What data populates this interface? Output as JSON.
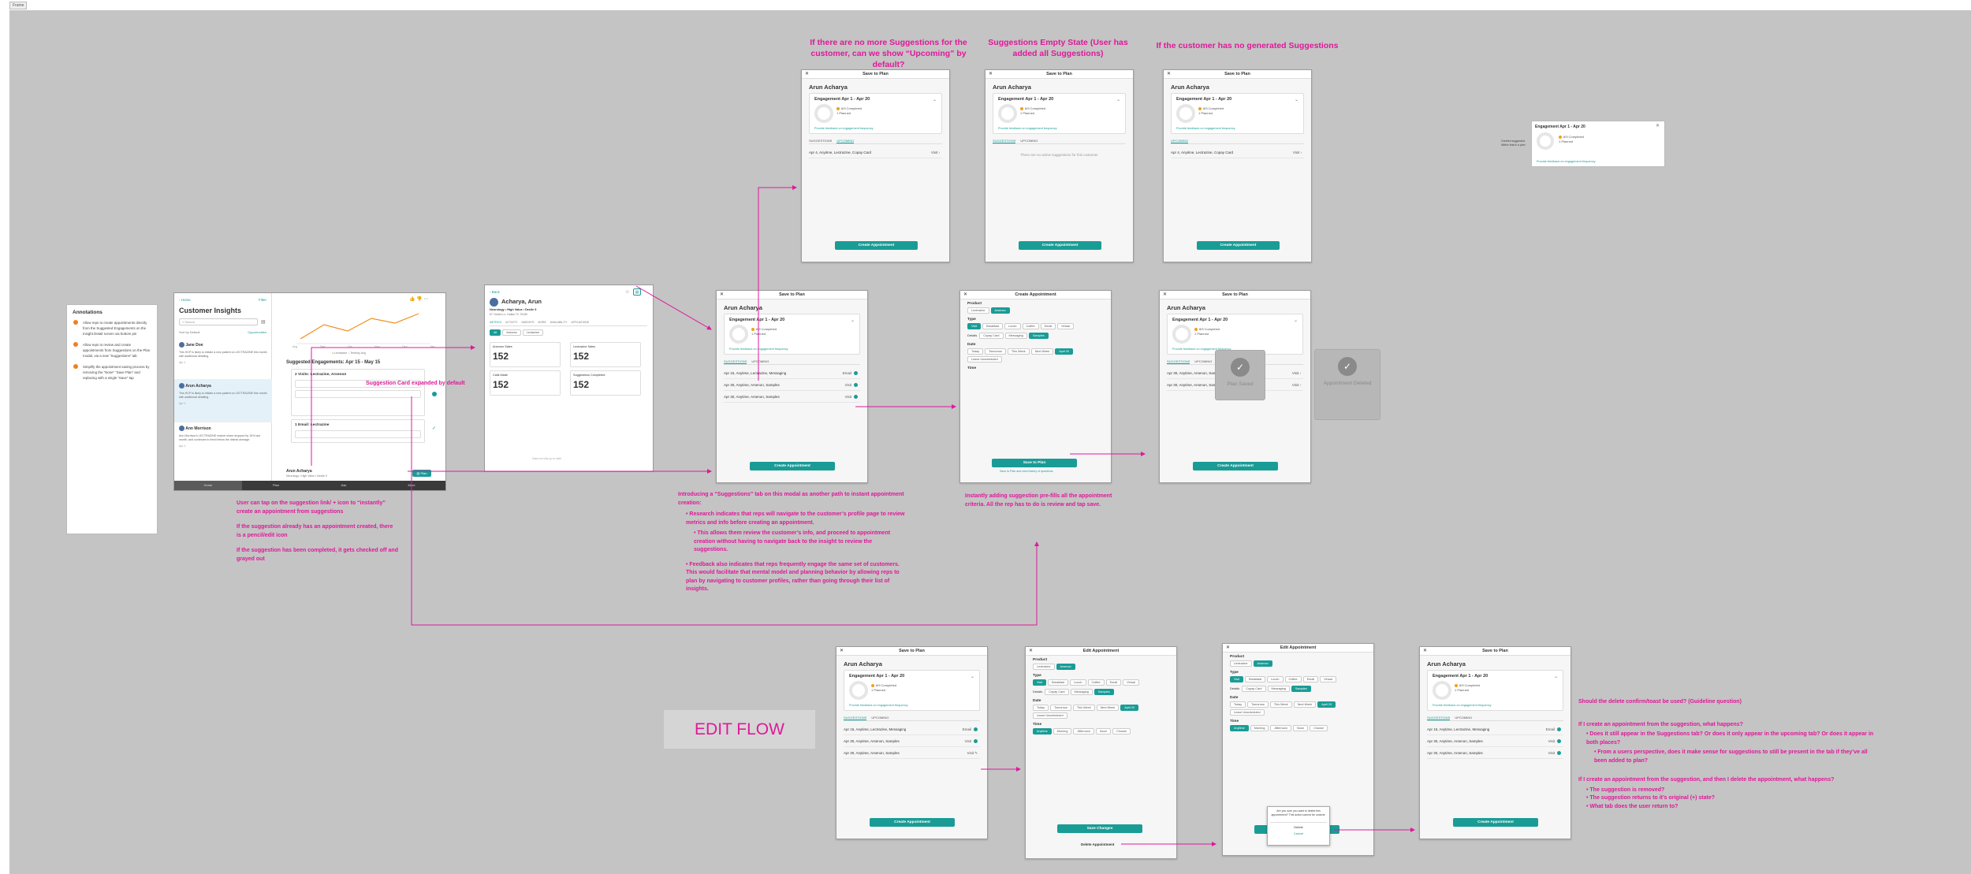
{
  "frame_tag": "Frame",
  "captions": {
    "no_more": "If there are no more Suggestions for the customer, can we show “Upcoming” by default?",
    "empty_state": "Suggestions Empty State (User has added all Suggestions)",
    "no_generated": "If the customer has no generated Suggestions",
    "edit_flow": "EDIT FLOW",
    "card_expanded": "Suggestion Card expanded by default"
  },
  "notes": {
    "left": [
      "User can tap on the suggestion link/ + icon to “instantly” create an appointment from suggestions",
      "If the suggestion already has an appointment created, there is a pencil/edit icon",
      "If the suggestion has been completed, it gets checked off and grayed out"
    ],
    "center_intro": "Introducing a “Suggestions” tab on this modal as another path to instant appointment creation:",
    "center_b1": "Research indicates that reps will navigate to the customer’s profile page to review metrics and info before creating an appointment.",
    "center_b1s": "This allows them review the customer’s info, and proceed to appointment creation without having to navigate back to the insight to review the suggestions.",
    "center_b2": "Feedback also indicates that reps frequently engage the same set of customers.  This would facilitate that mental model and planning behavior by allowing reps to plan by navigating to customer profiles, rather than going through their list of insights.",
    "prefill": "Instantly adding suggestion pre-fills all the appointment criteria.  All the rep has to do is review and tap save.",
    "q_title": "Should the delete confirm/toast be used? (Guideline question)",
    "q2": "If I create an appointment from the suggestion, what happens?",
    "q2a": "Does it still appear in the Suggestions tab? Or does it only appear in the upcoming tab? Or does it appear in both places?",
    "q2b": "From a users perspective, does it make sense for suggestions to still be present in the tab if they’ve all been added to plan?",
    "q3": "If I create an appointment from the suggestion, and then I delete the appointment, what happens?",
    "q3a": "The suggestion is removed?",
    "q3b": "The suggestion returns to it’s original (+) state?",
    "q3c": "What tab does the user return to?",
    "side_note": "Greeted suggested. Within that is a plan"
  },
  "annotations": {
    "title": "Annotations",
    "items": [
      "Allow reps to create appointments directly from the Suggested Engagements on the Insight Detail screen via bottom pin",
      "Allow reps to review and create appointments from Suggestions on the Plan modal, via a new “Suggestions” tab",
      "Simplify the appointment saving process by removing the “None” “Save Plan” and replacing with a single “Save” tap"
    ]
  },
  "insights": {
    "back": "Home",
    "filter": "Filter",
    "title": "Customer Insights",
    "search": "Search",
    "sort_label": "Sort by",
    "sort_val": "Default",
    "view_label": "Opportunities",
    "items": [
      {
        "name": "Jane Doe",
        "text": "This HCP is likely to initiate a new patient on LECTRAZINE this month with additional detailing.",
        "time": "Apr 1"
      },
      {
        "name": "Arun Acharya",
        "text": "This HCP is likely to initiate a new patient on LECTRAZINE this month with additional detailing.",
        "time": "Apr 1"
      },
      {
        "name": "Ann Morrison",
        "text": "Ann Morrison's LECTRAZINE market share dropped by 15% last month, and continues to trend below the district average.",
        "time": "Apr 1"
      }
    ],
    "chart_months": [
      "Aug",
      "Sep",
      "Oct",
      "Nov",
      "Dec",
      "Jan"
    ],
    "legend": [
      "Lectrazine",
      "Territory Avg"
    ],
    "sugg_title": "Suggested Engagements: Apr 15 - May 15",
    "sugg": [
      {
        "title": "2 Visits: Lectrazine, Arsenon"
      },
      {
        "title": "1 Email: Lectrazine"
      }
    ],
    "footer_name": "Arun Acharya",
    "footer_sub": "Neurology • High Value • Decile 9",
    "footer_btn": "Plan",
    "tabs": [
      "Home",
      "Plan",
      "Ask",
      "More"
    ]
  },
  "profile": {
    "back": "Back",
    "name": "Acharya, Arun",
    "sub": "Neurology • High Value • Decile 9",
    "addr": "87 Yantez Ln, Dallas TX 75150",
    "tabs": [
      "METRICS",
      "ACTIVITY",
      "INSIGHTS",
      "MORE",
      "AVAILABILITY",
      "AFFILIATIONS"
    ],
    "chips": [
      "All",
      "Arrioran",
      "Lectazine"
    ],
    "metrics": [
      {
        "label": "Arsenon Sales",
        "val": "152"
      },
      {
        "label": "Lectrazine Sales",
        "val": "152"
      },
      {
        "label": "Calls Made",
        "val": "152"
      },
      {
        "label": "Suggestions Completed",
        "val": "152"
      }
    ],
    "footnote": "Data not fully up to date"
  },
  "modal": {
    "title": "Save to Plan",
    "customer": "Arun Acharya",
    "engagement": "Engagement Apr 1 - Apr 20",
    "legend1": "8/9 Completed",
    "legend2": "1 Planned",
    "feedback": "Provide feedback on engagement frequency",
    "tab_sugg": "SUGGESTIONS",
    "tab_up": "UPCOMING",
    "rows": [
      {
        "text": "Apr 15, Anytime, Lectrazine, Messaging",
        "right": "Email"
      },
      {
        "text": "Apr 30, Anytime, Arsenon, Samples",
        "right": "Visit"
      },
      {
        "text": "Apr 30, Anytime, Arsenon, Samples",
        "right": "Visit"
      }
    ],
    "upcoming_row": "Apr 4, Anytime, Lectrazine, Copay Card",
    "upcoming_right": "Visit",
    "empty": "There are no active suggestions for this customer",
    "button": "Create Appointment"
  },
  "create": {
    "title": "Create Appointment",
    "product": "Product",
    "products": [
      "Lectrazine",
      "Arsenon"
    ],
    "type": "Type",
    "types": [
      "Visit",
      "Breakfast",
      "Lunch",
      "Coffee",
      "Email",
      "Virtual"
    ],
    "details": "Details",
    "details_opts": [
      "Copay Card",
      "Messaging",
      "Samples"
    ],
    "date": "Date",
    "dates": [
      "Today",
      "Tomorrow",
      "This Week",
      "Next Week",
      "April 20",
      "Leave Unscheduled"
    ],
    "time": "Time",
    "times": [
      "Anytime",
      "Morning",
      "Afternoon",
      "Noon",
      "Choose"
    ],
    "save": "Save to Plan",
    "note": "Save to Plan and view history of questions"
  },
  "edit": {
    "title": "Edit Appointment",
    "save": "Save Changes",
    "delete": "Delete Appointment",
    "confirm": "Are you sure you want to delete this appointment? This action cannot be undone.",
    "confirm_del": "Delete",
    "confirm_cancel": "Cancel"
  },
  "overlays": {
    "saved": "Plan Saved",
    "deleted": "Appointment Deleted"
  },
  "side_card": {
    "title": "Engagement Apr 1 - Apr 20",
    "l1": "8/9 Completed",
    "l2": "1 Planned",
    "fb": "Provide feedback on engagement frequency"
  }
}
